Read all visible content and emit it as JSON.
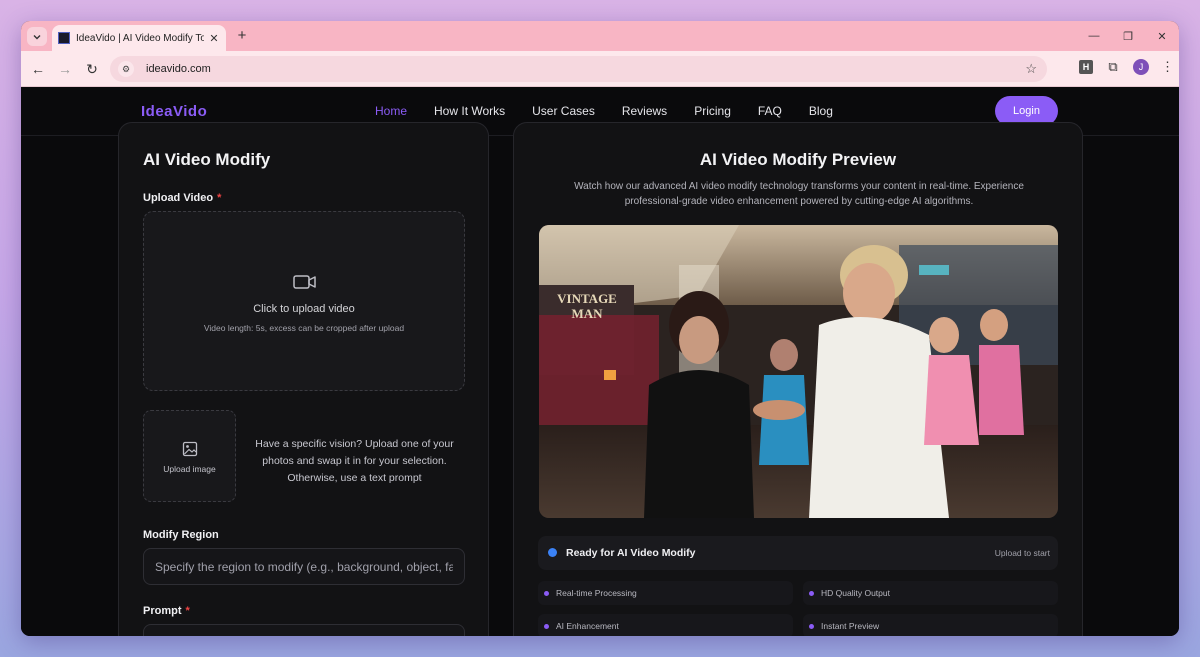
{
  "browser": {
    "tab_title": "IdeaVido | AI Video Modify Tool",
    "url": "ideavido.com",
    "profile_initial": "J",
    "extension_label": "H"
  },
  "header": {
    "logo": "IdeaVido",
    "nav": [
      "Home",
      "How It Works",
      "User Cases",
      "Reviews",
      "Pricing",
      "FAQ",
      "Blog"
    ],
    "active_nav": "Home",
    "login": "Login"
  },
  "left": {
    "title": "AI Video Modify",
    "upload_video_label": "Upload Video",
    "upload_video_cta": "Click to upload video",
    "upload_video_hint": "Video length: 5s, excess can be cropped after upload",
    "upload_image_label": "Upload image",
    "vision_text": "Have a specific vision? Upload one of your photos and swap it in for your selection. Otherwise, use a text prompt",
    "modify_region_label": "Modify Region",
    "modify_region_placeholder": "Specify the region to modify (e.g., background, object, face)",
    "prompt_label": "Prompt",
    "required_mark": "*"
  },
  "right": {
    "title": "AI Video Modify Preview",
    "description": "Watch how our advanced AI video modify technology transforms your content in real-time. Experience professional-grade video enhancement powered by cutting-edge AI algorithms.",
    "preview_sign": "VINTAGE MAN",
    "status": "Ready for AI Video Modify",
    "status_hint": "Upload to start",
    "features": [
      "Real-time Processing",
      "HD Quality Output",
      "AI Enhancement",
      "Instant Preview"
    ]
  },
  "colors": {
    "accent": "#8b5cf6",
    "status_dot": "#3b82f6",
    "required": "#ef4444",
    "tab_strip": "#f8b5c4"
  }
}
